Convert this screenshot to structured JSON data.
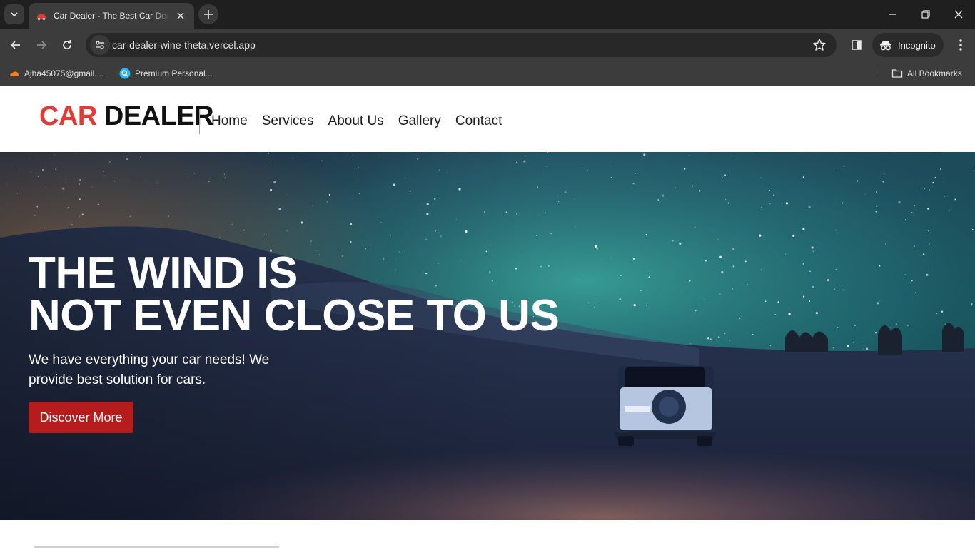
{
  "browser": {
    "tab_title": "Car Dealer - The Best Car Dealer",
    "url": "car-dealer-wine-theta.vercel.app",
    "incognito_label": "Incognito",
    "bookmarks": [
      {
        "label": "Ajha45075@gmail...."
      },
      {
        "label": "Premium Personal..."
      }
    ],
    "all_bookmarks_label": "All Bookmarks"
  },
  "site": {
    "logo": {
      "part1": "CAR",
      "part2": "DEALER"
    },
    "nav": [
      "Home",
      "Services",
      "About Us",
      "Gallery",
      "Contact"
    ],
    "colors": {
      "accent": "#e53935",
      "button": "#b71c1c"
    }
  },
  "hero": {
    "title_line1": "THE WIND IS",
    "title_line2": "NOT EVEN CLOSE TO US",
    "subtitle": "We have everything your car needs! We provide best solution for cars.",
    "cta_label": "Discover More"
  }
}
